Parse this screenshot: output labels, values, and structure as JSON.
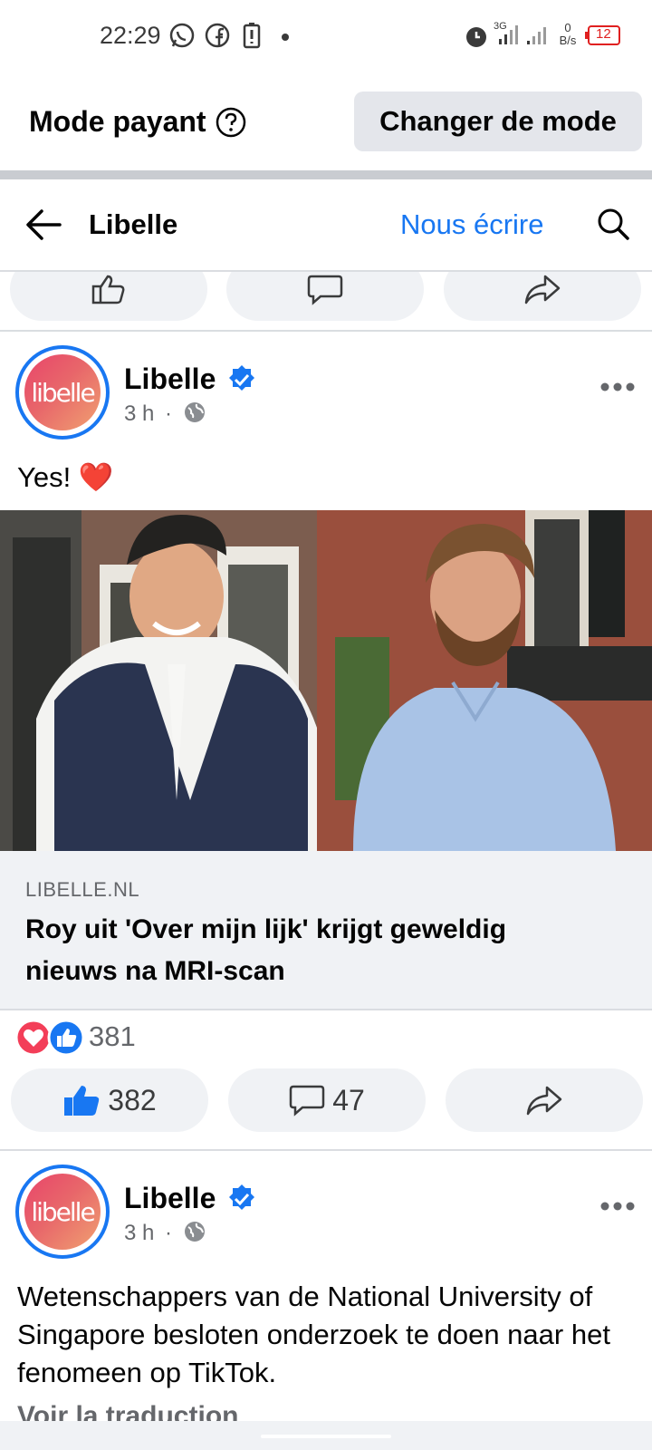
{
  "status_bar": {
    "time": "22:29",
    "network_speed": "0",
    "network_unit": "B/s",
    "battery": "12",
    "network_type": "3G",
    "icons": [
      "whatsapp-icon",
      "facebook-icon",
      "battery-saver-icon",
      "dot-icon",
      "alarm-icon",
      "signal-icon",
      "signal-icon-2",
      "battery-icon"
    ]
  },
  "mode_bar": {
    "label": "Mode payant",
    "button": "Changer de mode"
  },
  "header": {
    "title": "Libelle",
    "write_link": "Nous écrire"
  },
  "posts": [
    {
      "author": "Libelle",
      "avatar_text": "libelle",
      "time": "3 h",
      "separator": "·",
      "text": "Yes! ❤️",
      "link_domain": "LIBELLE.NL",
      "link_title": "Roy uit 'Over mijn lijk' krijgt geweldig nieuws na MRI-scan",
      "reactions_total": "381",
      "likes": "382",
      "comments": "47"
    },
    {
      "author": "Libelle",
      "avatar_text": "libelle",
      "time": "3 h",
      "separator": "·",
      "text": "Wetenschappers van de National University of Singapore besloten onderzoek te doen naar het fenomeen op TikTok.",
      "translate": "Voir la traduction"
    }
  ],
  "colors": {
    "accent": "#1877f2",
    "pill_bg": "#f0f2f5",
    "love": "#f33e58"
  }
}
